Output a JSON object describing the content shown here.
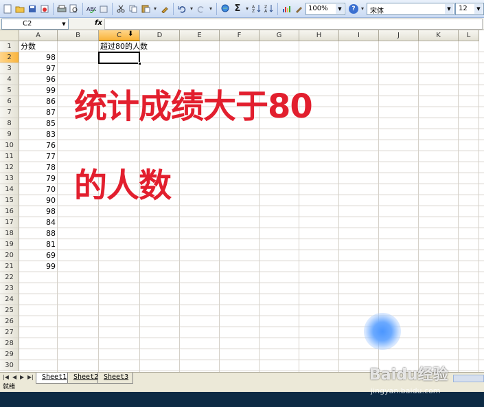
{
  "toolbar": {
    "zoom": "100%",
    "font": "宋体",
    "font_size": "12"
  },
  "formula_bar": {
    "name_box": "C2",
    "fx_label": "fx",
    "formula": ""
  },
  "columns": [
    "A",
    "B",
    "C",
    "D",
    "E",
    "F",
    "G",
    "H",
    "I",
    "J",
    "K",
    "L"
  ],
  "rows": [
    "1",
    "2",
    "3",
    "4",
    "5",
    "6",
    "7",
    "8",
    "9",
    "10",
    "11",
    "12",
    "13",
    "14",
    "15",
    "16",
    "17",
    "18",
    "19",
    "20",
    "21",
    "22",
    "23",
    "24",
    "25",
    "26",
    "27",
    "28",
    "29",
    "30"
  ],
  "active_cell": "C2",
  "cells": {
    "A1": "分数",
    "C1": "超过80的人数",
    "A_values": [
      98,
      97,
      96,
      99,
      86,
      87,
      85,
      83,
      76,
      77,
      78,
      79,
      70,
      90,
      98,
      84,
      88,
      81,
      69,
      99
    ]
  },
  "overlay": {
    "line1": "统计成绩大于80",
    "line2": "的人数"
  },
  "sheet_tabs": [
    "Sheet1",
    "Sheet2",
    "Sheet3"
  ],
  "active_sheet": "Sheet1",
  "status": "就绪",
  "watermark": {
    "logo": "Baidu经验",
    "url": "jingyan.baidu.com"
  }
}
